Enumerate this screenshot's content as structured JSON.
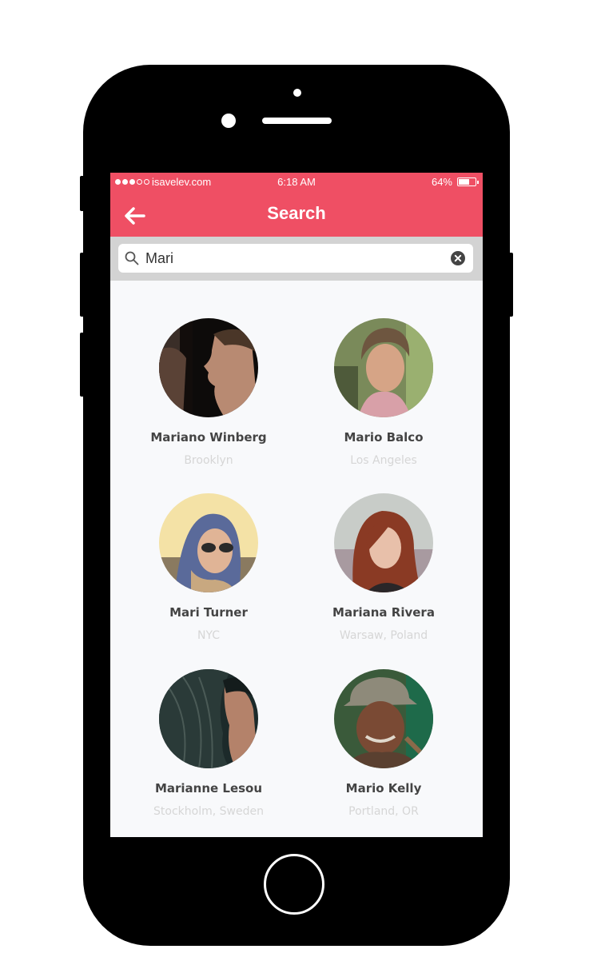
{
  "status": {
    "carrier": "isavelev.com",
    "time": "6:18 AM",
    "battery": "64%",
    "battery_level": 0.64
  },
  "nav": {
    "title": "Search"
  },
  "search": {
    "value": "Mari"
  },
  "results": [
    {
      "name": "Mariano Winberg",
      "location": "Brooklyn"
    },
    {
      "name": "Mario Balco",
      "location": "Los Angeles"
    },
    {
      "name": "Mari Turner",
      "location": "NYC"
    },
    {
      "name": "Mariana Rivera",
      "location": "Warsaw, Poland"
    },
    {
      "name": "Marianne Lesou",
      "location": "Stockholm, Sweden"
    },
    {
      "name": "Mario Kelly",
      "location": "Portland, OR"
    }
  ],
  "colors": {
    "accent": "#ef4f64",
    "search_bar_bg": "#d3d3d3",
    "background": "#f8f9fb"
  }
}
